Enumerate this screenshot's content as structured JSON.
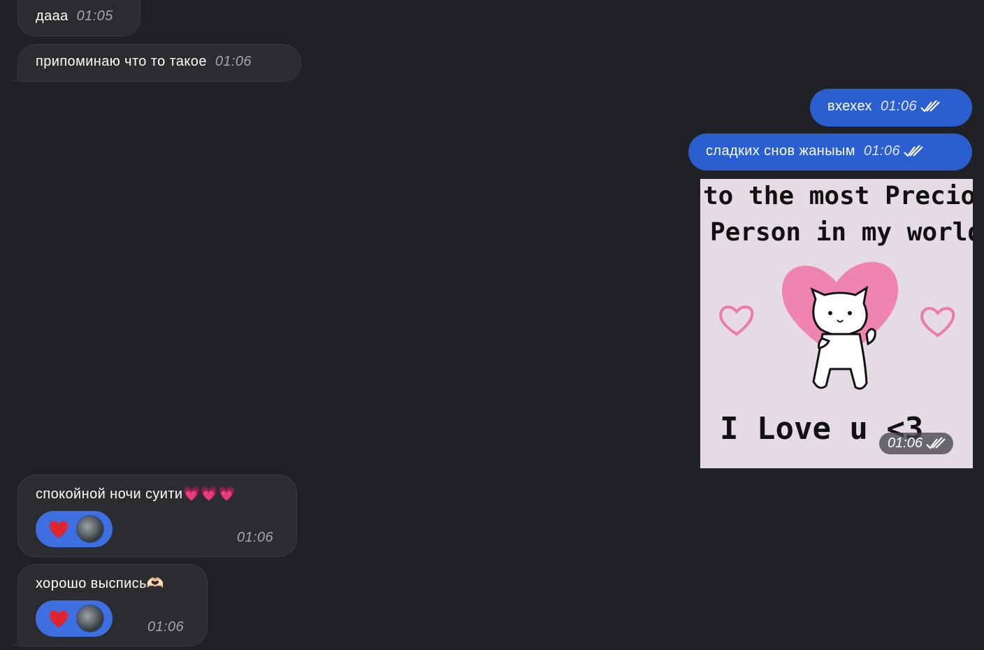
{
  "messages": [
    {
      "id": "m1",
      "direction": "in",
      "text": "дааа",
      "time": "01:05"
    },
    {
      "id": "m2",
      "direction": "in",
      "text": "припоминаю что то такое",
      "time": "01:06"
    },
    {
      "id": "m3",
      "direction": "out",
      "text": "вхехех",
      "time": "01:06",
      "status": "read"
    },
    {
      "id": "m4",
      "direction": "out",
      "text": "сладких снов жаныым",
      "time": "01:06",
      "status": "read"
    },
    {
      "id": "m5",
      "direction": "out",
      "type": "sticker",
      "time": "01:06",
      "status": "read",
      "sticker_text": [
        "to the most Precious",
        "Person in my world",
        "I Love u <3"
      ]
    },
    {
      "id": "m6",
      "direction": "in",
      "text": "спокойной ночи суити",
      "emoji": "💗💗💗",
      "time": "01:06",
      "reaction": "❤️"
    },
    {
      "id": "m7",
      "direction": "in",
      "text": "хорошо выспись",
      "emoji": "🫶🏻",
      "time": "01:06",
      "reaction": "❤️"
    }
  ],
  "colors": {
    "background": "#1f2124",
    "incoming_bubble": "#2b2c2f",
    "outgoing_bubble": "#2b5fcf",
    "reaction_pill": "#3d6fe0"
  },
  "icons": {
    "read_status": "double-check-icon",
    "reaction_user": "avatar"
  }
}
